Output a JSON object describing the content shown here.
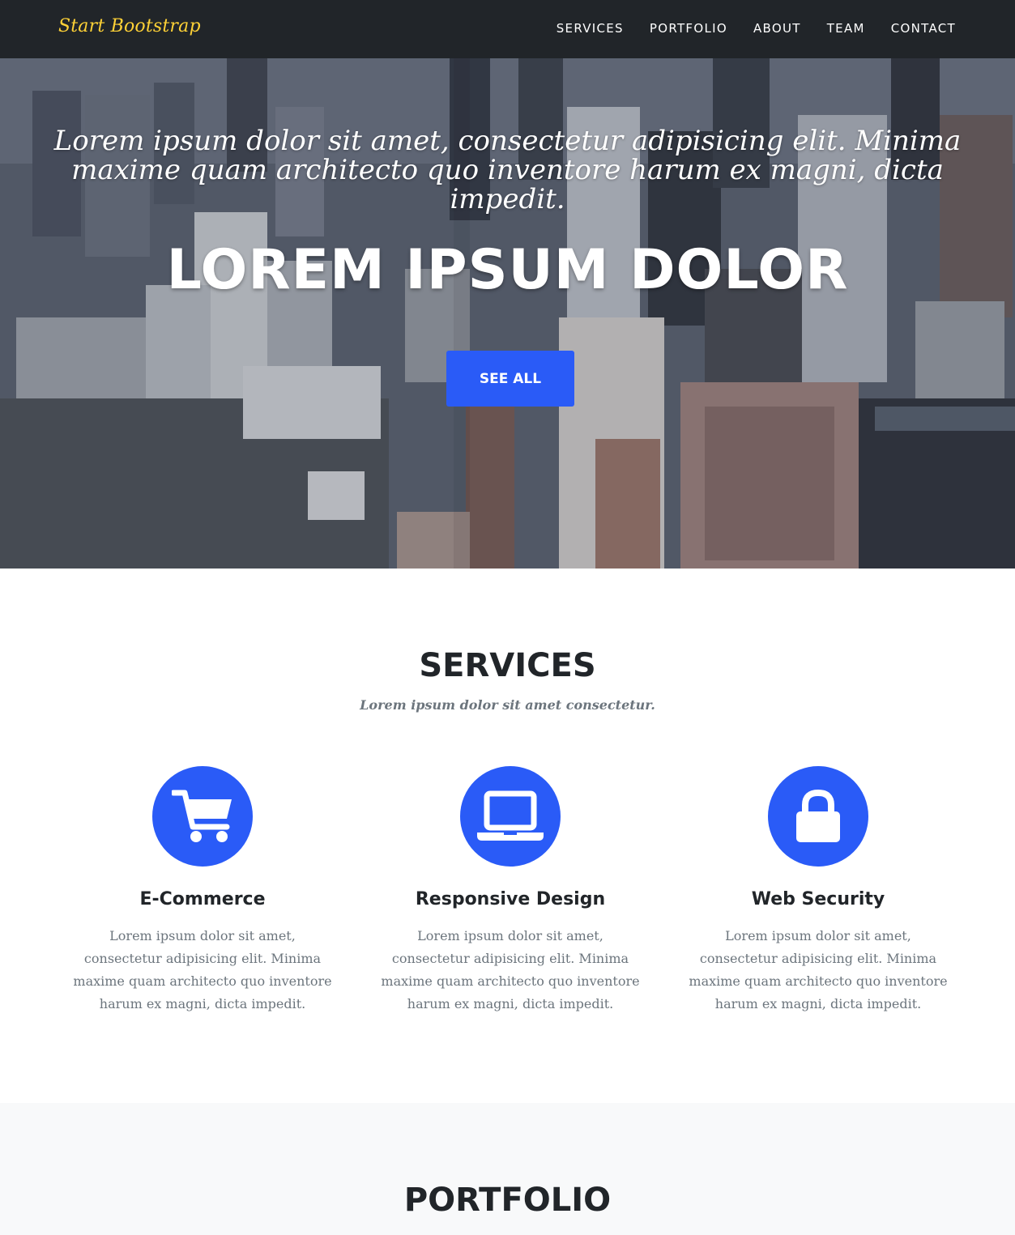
{
  "navbar": {
    "brand": "Start Bootstrap",
    "links": [
      {
        "label": "SERVICES"
      },
      {
        "label": "PORTFOLIO"
      },
      {
        "label": "ABOUT"
      },
      {
        "label": "TEAM"
      },
      {
        "label": "CONTACT"
      }
    ]
  },
  "hero": {
    "subheading": "Lorem ipsum dolor sit amet, consectetur adipisicing elit. Minima maxime quam architecto quo inventore harum ex magni, dicta impedit.",
    "heading": "LOREM IPSUM DOLOR",
    "button_label": "SEE ALL"
  },
  "services": {
    "title": "SERVICES",
    "subtitle": "Lorem ipsum dolor sit amet consectetur.",
    "items": [
      {
        "icon": "shopping-cart-icon",
        "title": "E-Commerce",
        "text": "Lorem ipsum dolor sit amet, consectetur adipisicing elit. Minima maxime quam architecto quo inventore harum ex magni, dicta impedit."
      },
      {
        "icon": "laptop-icon",
        "title": "Responsive Design",
        "text": "Lorem ipsum dolor sit amet, consectetur adipisicing elit. Minima maxime quam architecto quo inventore harum ex magni, dicta impedit."
      },
      {
        "icon": "lock-icon",
        "title": "Web Security",
        "text": "Lorem ipsum dolor sit amet, consectetur adipisicing elit. Minima maxime quam architecto quo inventore harum ex magni, dicta impedit."
      }
    ]
  },
  "portfolio": {
    "title": "PORTFOLIO"
  },
  "colors": {
    "navbar_bg": "#212529",
    "brand": "#fed136",
    "accent": "#2a5bf7",
    "heading": "#212529",
    "muted": "#6c757d",
    "section_alt_bg": "#f8f9fa"
  }
}
